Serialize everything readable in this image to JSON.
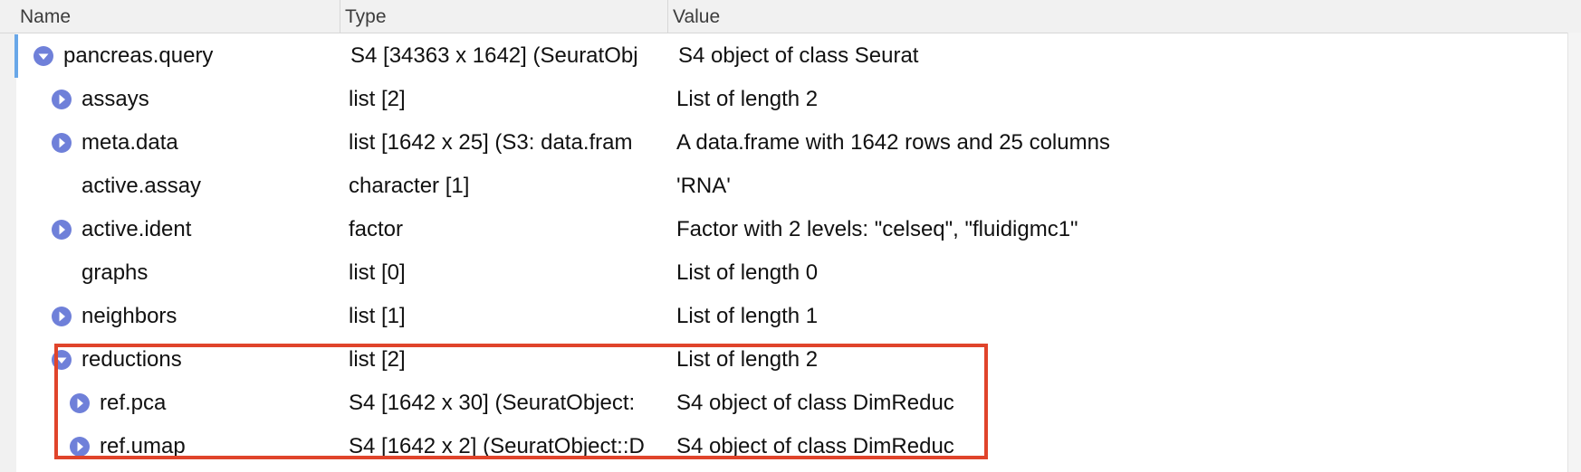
{
  "columns": {
    "name": "Name",
    "type": "Type",
    "value": "Value"
  },
  "colors": {
    "toggle": "#6f80d9",
    "highlight": "#e0442b",
    "selection": "#69a7e8"
  },
  "rows": [
    {
      "name": "pancreas.query",
      "type": "S4 [34363 x 1642] (SeuratObj",
      "value": "S4 object of class Seurat",
      "icon": "chevron-down-icon"
    },
    {
      "name": "assays",
      "type": "list [2]",
      "value": "List of length 2",
      "icon": "chevron-right-icon"
    },
    {
      "name": "meta.data",
      "type": "list [1642 x 25] (S3: data.fram",
      "value": "A data.frame with 1642 rows and 25 columns",
      "icon": "chevron-right-icon"
    },
    {
      "name": "active.assay",
      "type": "character [1]",
      "value": "'RNA'",
      "icon": ""
    },
    {
      "name": "active.ident",
      "type": "factor",
      "value": "Factor with 2 levels: \"celseq\", \"fluidigmc1\"",
      "icon": "chevron-right-icon"
    },
    {
      "name": "graphs",
      "type": "list [0]",
      "value": "List of length 0",
      "icon": ""
    },
    {
      "name": "neighbors",
      "type": "list [1]",
      "value": "List of length 1",
      "icon": "chevron-right-icon"
    },
    {
      "name": "reductions",
      "type": "list [2]",
      "value": "List of length 2",
      "icon": "chevron-down-icon"
    },
    {
      "name": "ref.pca",
      "type": "S4 [1642 x 30] (SeuratObject:",
      "value": "S4 object of class DimReduc",
      "icon": "chevron-right-icon"
    },
    {
      "name": "ref.umap",
      "type": "S4 [1642 x 2] (SeuratObject::D",
      "value": "S4 object of class DimReduc",
      "icon": "chevron-right-icon"
    }
  ]
}
